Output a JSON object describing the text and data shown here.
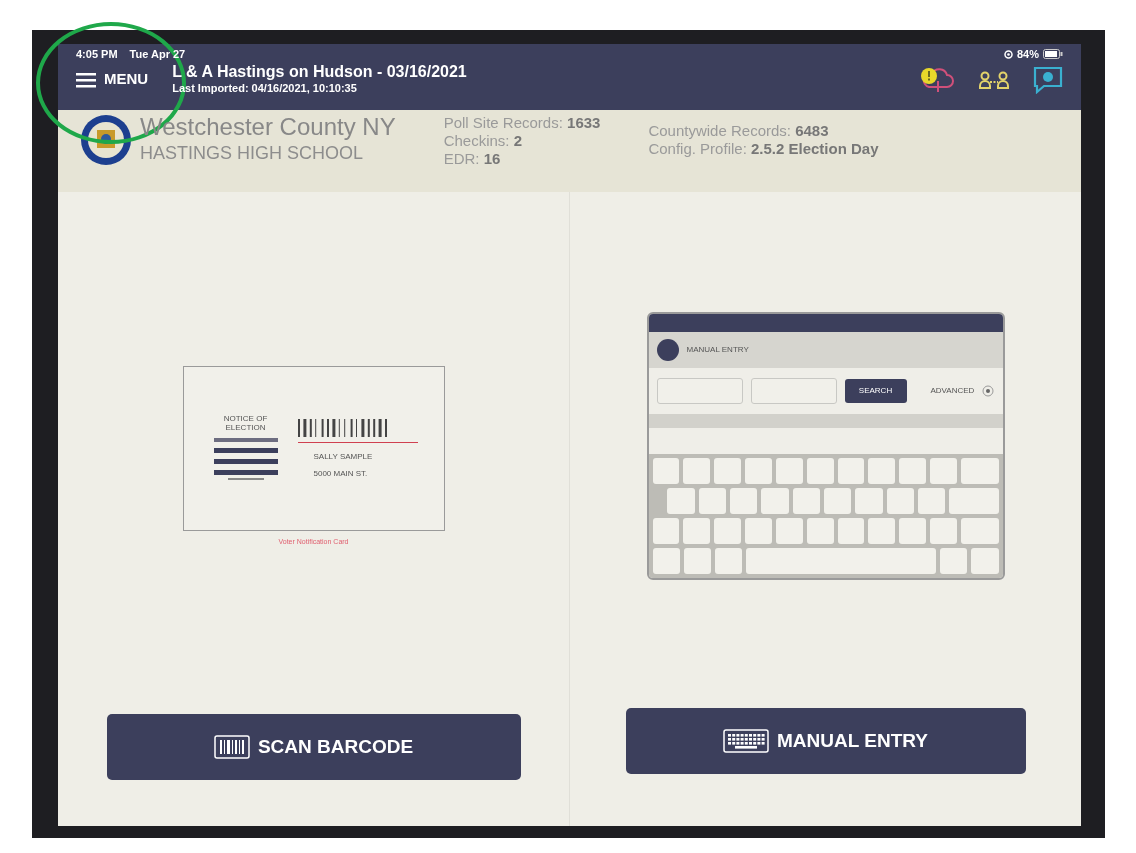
{
  "status_bar": {
    "time": "4:05 PM",
    "date": "Tue Apr 27",
    "battery": "84%"
  },
  "navbar": {
    "menu_label": "MENU",
    "title": "L & A Hastings on Hudson  - 03/16/2021",
    "subtitle": "Last Imported: 04/16/2021, 10:10:35"
  },
  "site": {
    "county": "Westchester County NY",
    "location": "HASTINGS HIGH SCHOOL"
  },
  "stats_left": [
    {
      "label": "Poll Site Records:",
      "value": "1633"
    },
    {
      "label": "Checkins:",
      "value": "2"
    },
    {
      "label": "EDR:",
      "value": "16"
    }
  ],
  "stats_right": [
    {
      "label": "Countywide Records:",
      "value": "6483"
    },
    {
      "label": "Config. Profile:",
      "value": "2.5.2 Election Day"
    }
  ],
  "scan_panel": {
    "card": {
      "heading": "NOTICE OF ELECTION",
      "name": "SALLY SAMPLE",
      "address": "5000 MAIN ST."
    },
    "caption": "Voter Notification Card",
    "button": "SCAN BARCODE"
  },
  "manual_panel": {
    "preview": {
      "title": "MANUAL ENTRY",
      "search_button": "SEARCH",
      "advanced": "ADVANCED"
    },
    "button": "MANUAL ENTRY"
  }
}
